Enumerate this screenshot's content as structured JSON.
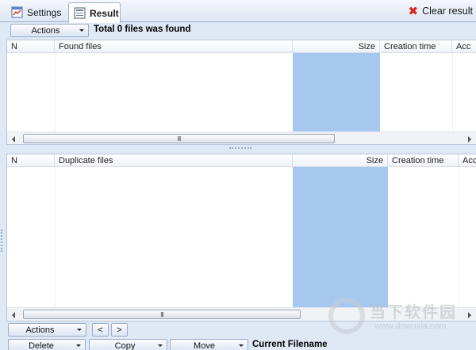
{
  "tabs": {
    "settings_label": "Settings",
    "result_label": "Result",
    "clear_result_label": "Clear result"
  },
  "top_toolbar": {
    "actions_label": "Actions",
    "status_text": "Total 0 files was found"
  },
  "found_grid": {
    "columns": [
      "N",
      "Found files",
      "Size",
      "Creation time",
      "Acc"
    ],
    "rows": []
  },
  "duplicate_grid": {
    "columns": [
      "N",
      "Duplicate files",
      "Size",
      "Creation time",
      "Acc"
    ],
    "rows": []
  },
  "scrollbar": {
    "thumb_grip": "III"
  },
  "bottom_toolbar": {
    "actions_label": "Actions",
    "prev_label": "<",
    "next_label": ">",
    "delete_label": "Delete",
    "copy_label": "Copy",
    "move_label": "Move",
    "current_filename_label": "Current Filename"
  },
  "watermark": {
    "cn_text": "当下软件园",
    "url_text": "www.downxia.com"
  },
  "colors": {
    "size_column_highlight": "#a6c8ef",
    "clear_icon": "#d9261c",
    "background": "#dfe8f5"
  }
}
